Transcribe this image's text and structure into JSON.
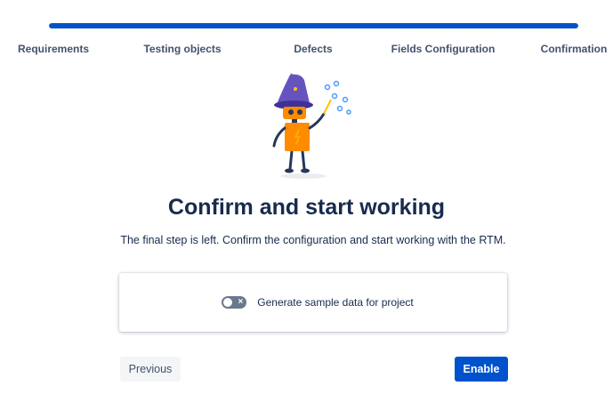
{
  "progress": {
    "value": 1.0,
    "fill_color": "#0052cc",
    "track_color": "#dfe1e6"
  },
  "steps": [
    {
      "label": "Requirements"
    },
    {
      "label": "Testing objects"
    },
    {
      "label": "Defects"
    },
    {
      "label": "Fields Configuration"
    },
    {
      "label": "Confirmation"
    }
  ],
  "illustration": {
    "icon": "wizard-robot-illustration"
  },
  "main": {
    "title": "Confirm and start working",
    "subtitle": "The final step is left. Confirm the configuration and start working with the RTM."
  },
  "options": {
    "sample_data_label": "Generate sample data for project",
    "sample_data_enabled": false
  },
  "footer": {
    "previous_label": "Previous",
    "enable_label": "Enable"
  },
  "colors": {
    "primary": "#0052cc",
    "text": "#172b4d",
    "muted": "#42526e"
  }
}
